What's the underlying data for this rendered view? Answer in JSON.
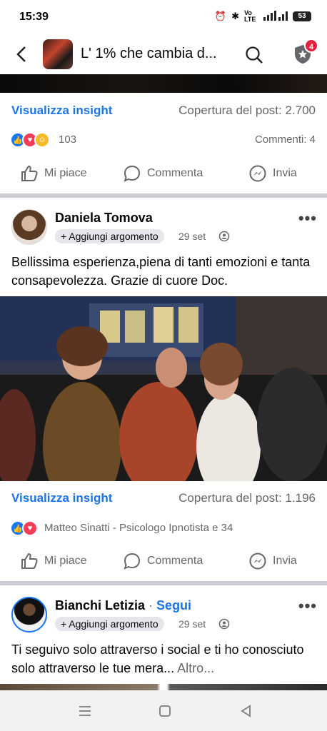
{
  "status": {
    "time": "15:39",
    "net": "Vo LTE",
    "signal": "4G",
    "battery": "53"
  },
  "header": {
    "group_title": "L' 1% che cambia d...",
    "notifications": "4"
  },
  "post1_footer": {
    "insight": "Visualizza insight",
    "coverage": "Copertura del post: 2.700",
    "reaction_count": "103",
    "comments": "Commenti: 4"
  },
  "actions": {
    "like": "Mi piace",
    "comment": "Commenta",
    "share": "Invia"
  },
  "post2": {
    "author": "Daniela Tomova",
    "tag": "+ Aggiungi argomento",
    "date": "29 set",
    "text": "Bellissima esperienza,piena di tanti emozioni e tanta consapevolezza. Grazie di cuore  Doc.",
    "insight": "Visualizza insight",
    "coverage": "Copertura del post: 1.196",
    "reactors": "Matteo Sinatti - Psicologo Ipnotista e 34"
  },
  "post3": {
    "author": "Bianchi Letizia",
    "follow": "Segui",
    "tag": "+ Aggiungi argomento",
    "date": "29 set",
    "text": "Ti seguivo solo attraverso i social e ti ho conosciuto solo attraverso le tue mera...",
    "more": " Altro..."
  },
  "colors": {
    "accent": "#1b74e4",
    "badge": "#e41e3f",
    "secondary_text": "#65676b"
  },
  "icons": [
    "back-arrow-icon",
    "search-icon",
    "shield-icon",
    "like-icon",
    "comment-icon",
    "share-icon",
    "globe-icon",
    "more-icon"
  ]
}
